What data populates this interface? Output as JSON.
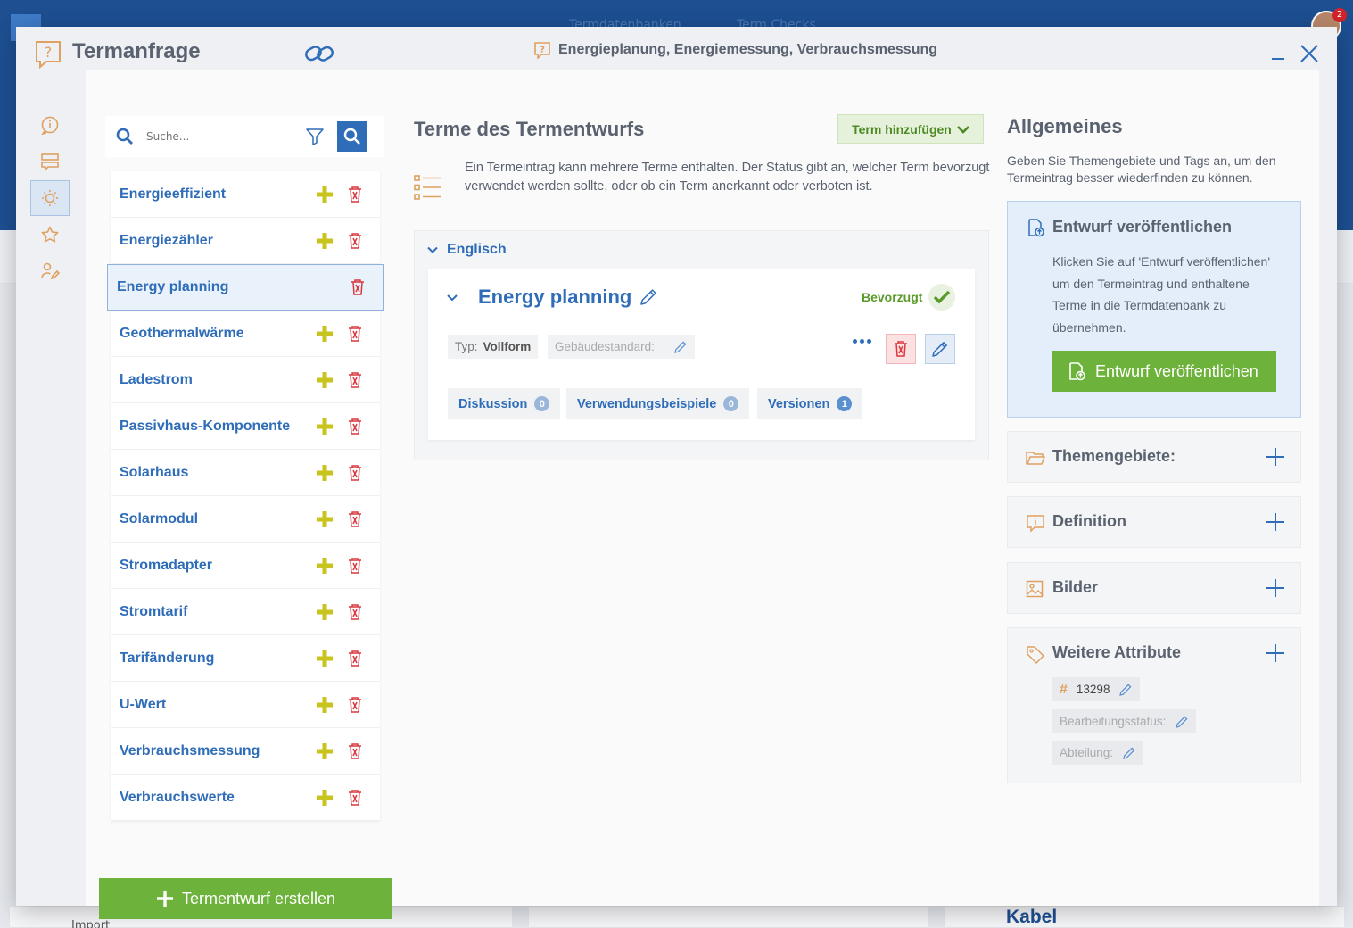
{
  "background": {
    "nav": [
      "Termdatenbanken",
      "Term Checks"
    ],
    "notification_count": "2",
    "card_texts": [
      "Kabel",
      "Import"
    ]
  },
  "modal": {
    "title": "Termanfrage",
    "subtitle": "Energieplanung, Energiemessung, Verbrauchsmessung"
  },
  "search": {
    "placeholder": "Suche..."
  },
  "terms": [
    {
      "label": "Energieeffizient",
      "selected": false
    },
    {
      "label": "Energiezähler",
      "selected": false
    },
    {
      "label": "Energy planning",
      "selected": true
    },
    {
      "label": "Geothermalwärme",
      "selected": false
    },
    {
      "label": "Ladestrom",
      "selected": false
    },
    {
      "label": "Passivhaus-Komponente",
      "selected": false
    },
    {
      "label": "Solarhaus",
      "selected": false
    },
    {
      "label": "Solarmodul",
      "selected": false
    },
    {
      "label": "Stromadapter",
      "selected": false
    },
    {
      "label": "Stromtarif",
      "selected": false
    },
    {
      "label": "Tarifänderung",
      "selected": false
    },
    {
      "label": "U-Wert",
      "selected": false
    },
    {
      "label": "Verbrauchsmessung",
      "selected": false
    },
    {
      "label": "Verbrauchswerte",
      "selected": false
    }
  ],
  "create_button": "Termentwurf erstellen",
  "middle": {
    "title": "Terme des Termentwurfs",
    "add_term_button": "Term hinzufügen",
    "info": "Ein Termeintrag kann mehrere Terme enthalten. Der Status gibt an, welcher Term bevorzugt verwendet werden sollte, oder ob ein Term anerkannt oder verboten ist.",
    "language": "Englisch",
    "term_card": {
      "name": "Energy planning",
      "status": "Bevorzugt",
      "type_label": "Typ:",
      "type_value": "Vollform",
      "standard_label": "Gebäudestandard:",
      "tabs": [
        {
          "label": "Diskussion",
          "count": "0"
        },
        {
          "label": "Verwendungsbeispiele",
          "count": "0"
        },
        {
          "label": "Versionen",
          "count": "1"
        }
      ]
    }
  },
  "right": {
    "title": "Allgemeines",
    "description": "Geben Sie Themengebiete und Tags an, um den Termeintrag besser wiederfinden zu können.",
    "publish": {
      "title": "Entwurf veröffentlichen",
      "text": "Klicken Sie auf 'Entwurf veröffentlichen' um den Termeintrag und enthaltene Terme in die Termdatenbank zu übernehmen.",
      "button": "Entwurf veröffentlichen"
    },
    "sections": {
      "themen": "Themengebiete:",
      "definition": "Definition",
      "bilder": "Bilder",
      "attribute": "Weitere Attribute"
    },
    "attributes": {
      "id": "13298",
      "status_label": "Bearbeitungsstatus:",
      "dept_label": "Abteilung:"
    }
  },
  "colors": {
    "primary": "#2f6db8",
    "accent_green": "#6db23a",
    "add_yellow": "#c8c31d",
    "delete_red": "#d9393f",
    "orange_icon": "#e0a060"
  }
}
